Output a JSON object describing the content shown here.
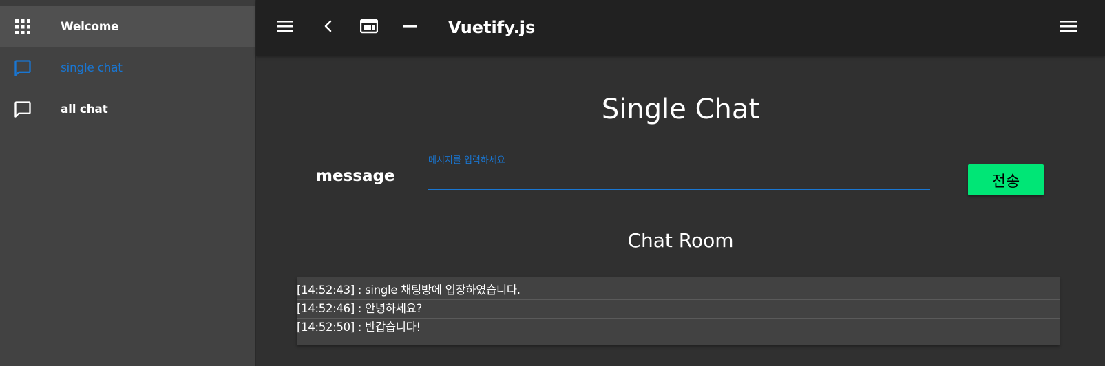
{
  "sidebar": {
    "items": [
      {
        "label": "Welcome",
        "icon": "apps-grid-icon"
      },
      {
        "label": "single chat",
        "icon": "chat-icon"
      },
      {
        "label": "all chat",
        "icon": "chat-icon"
      }
    ]
  },
  "toolbar": {
    "title": "Vuetify.js",
    "icons": [
      "menu-icon",
      "chevron-left-icon",
      "web-layout-icon",
      "minimize-icon",
      "menu-icon"
    ]
  },
  "main": {
    "title": "Single Chat",
    "message_label": "message",
    "input_label": "메시지를 입력하세요",
    "input_value": "",
    "send_label": "전송",
    "room_title": "Chat Room",
    "messages": [
      "[14:52:43] : single 채팅방에 입장하였습니다.",
      "[14:52:46] : 안녕하세요?",
      "[14:52:50] : 반갑습니다!"
    ]
  },
  "colors": {
    "accent": "#1976d2",
    "send_button": "#00e676",
    "toolbar": "#212121",
    "sidebar": "#424242",
    "background": "#303030"
  }
}
